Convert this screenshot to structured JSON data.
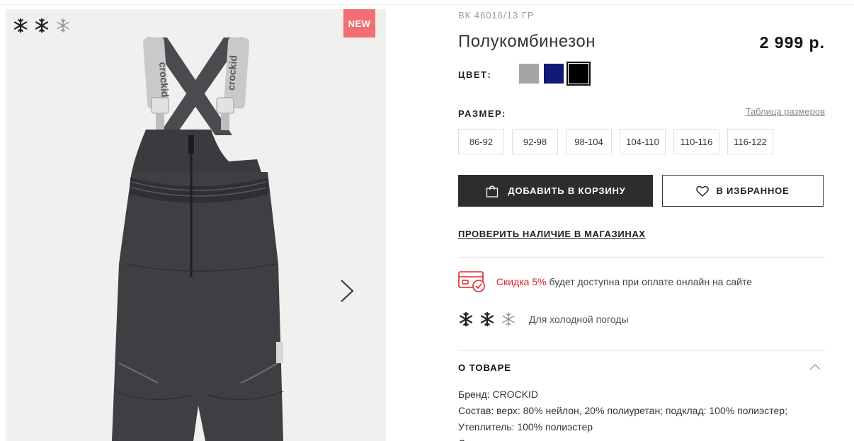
{
  "gallery": {
    "badge": "NEW",
    "snowflakes": [
      "snowflake-icon",
      "snowflake-icon",
      "snowflake-outline-icon"
    ],
    "next_icon": "chevron-right-icon",
    "strap_text": "crockid"
  },
  "product": {
    "article": "ВК 46016/13 ГР",
    "title": "Полукомбинезон",
    "price": "2 999 р."
  },
  "colors": {
    "label": "ЦВЕТ:",
    "swatches": [
      "#a4a4a4",
      "#111a74",
      "#000000"
    ],
    "selected_index": 2
  },
  "sizes": {
    "label": "РАЗМЕР:",
    "table_link": "Таблица размеров",
    "items": [
      "86-92",
      "92-98",
      "98-104",
      "104-110",
      "110-116",
      "116-122"
    ]
  },
  "actions": {
    "cart": "ДОБАВИТЬ В КОРЗИНУ",
    "favorite": "В ИЗБРАННОЕ",
    "check_stores": "ПРОВЕРИТЬ НАЛИЧИЕ В МАГАЗИНАХ"
  },
  "discount": {
    "highlight": "Скидка 5%",
    "text": " будет доступна при оплате онлайн на сайте",
    "accent": "#e0242b"
  },
  "weather": {
    "text": "Для холодной погоды"
  },
  "about": {
    "title": "О ТОВАРЕ",
    "lines": [
      "Бренд: CROCKID",
      "Состав: верх: 80% нейлон, 20% полиуретан; подклад: 100% полиэстер;",
      "Утеплитель: 100% полиэстер",
      "Сезон: весна-лето"
    ]
  }
}
